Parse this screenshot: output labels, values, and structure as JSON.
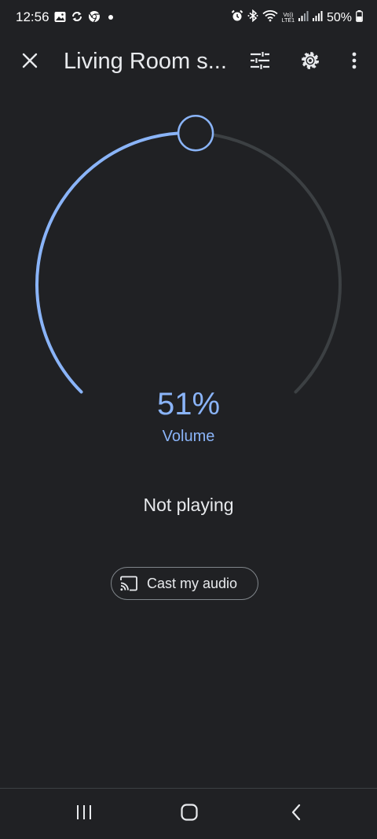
{
  "status_bar": {
    "time": "12:56",
    "left_icons": [
      "gallery-icon",
      "sync-icon",
      "chrome-icon",
      "notification-dot-icon"
    ],
    "right_icons": [
      "alarm-icon",
      "bluetooth-icon",
      "wifi-icon",
      "volte-icon",
      "signal-icon",
      "signal-icon",
      "battery-icon"
    ],
    "volte_label_top": "Vo))",
    "volte_label_bottom": "LTE1",
    "battery_percent": "50%"
  },
  "app_bar": {
    "close_icon": "close-icon",
    "title": "Living Room s...",
    "equalizer_icon": "equalizer-icon",
    "settings_icon": "gear-icon",
    "more_icon": "more-vert-icon"
  },
  "volume": {
    "level_percent": 51,
    "value_text": "51%",
    "label": "Volume",
    "colors": {
      "active": "#8ab4f8",
      "track": "#3c4043",
      "thumb_fill": "#202124"
    }
  },
  "playback": {
    "status": "Not playing"
  },
  "cast": {
    "icon": "cast-icon",
    "label": "Cast my audio"
  },
  "nav_bar": {
    "icons": [
      "recent-apps-icon",
      "home-icon",
      "back-icon"
    ]
  },
  "colors": {
    "background": "#202124",
    "text_primary": "#e8eaed",
    "accent": "#8ab4f8",
    "outline": "#80868b"
  }
}
